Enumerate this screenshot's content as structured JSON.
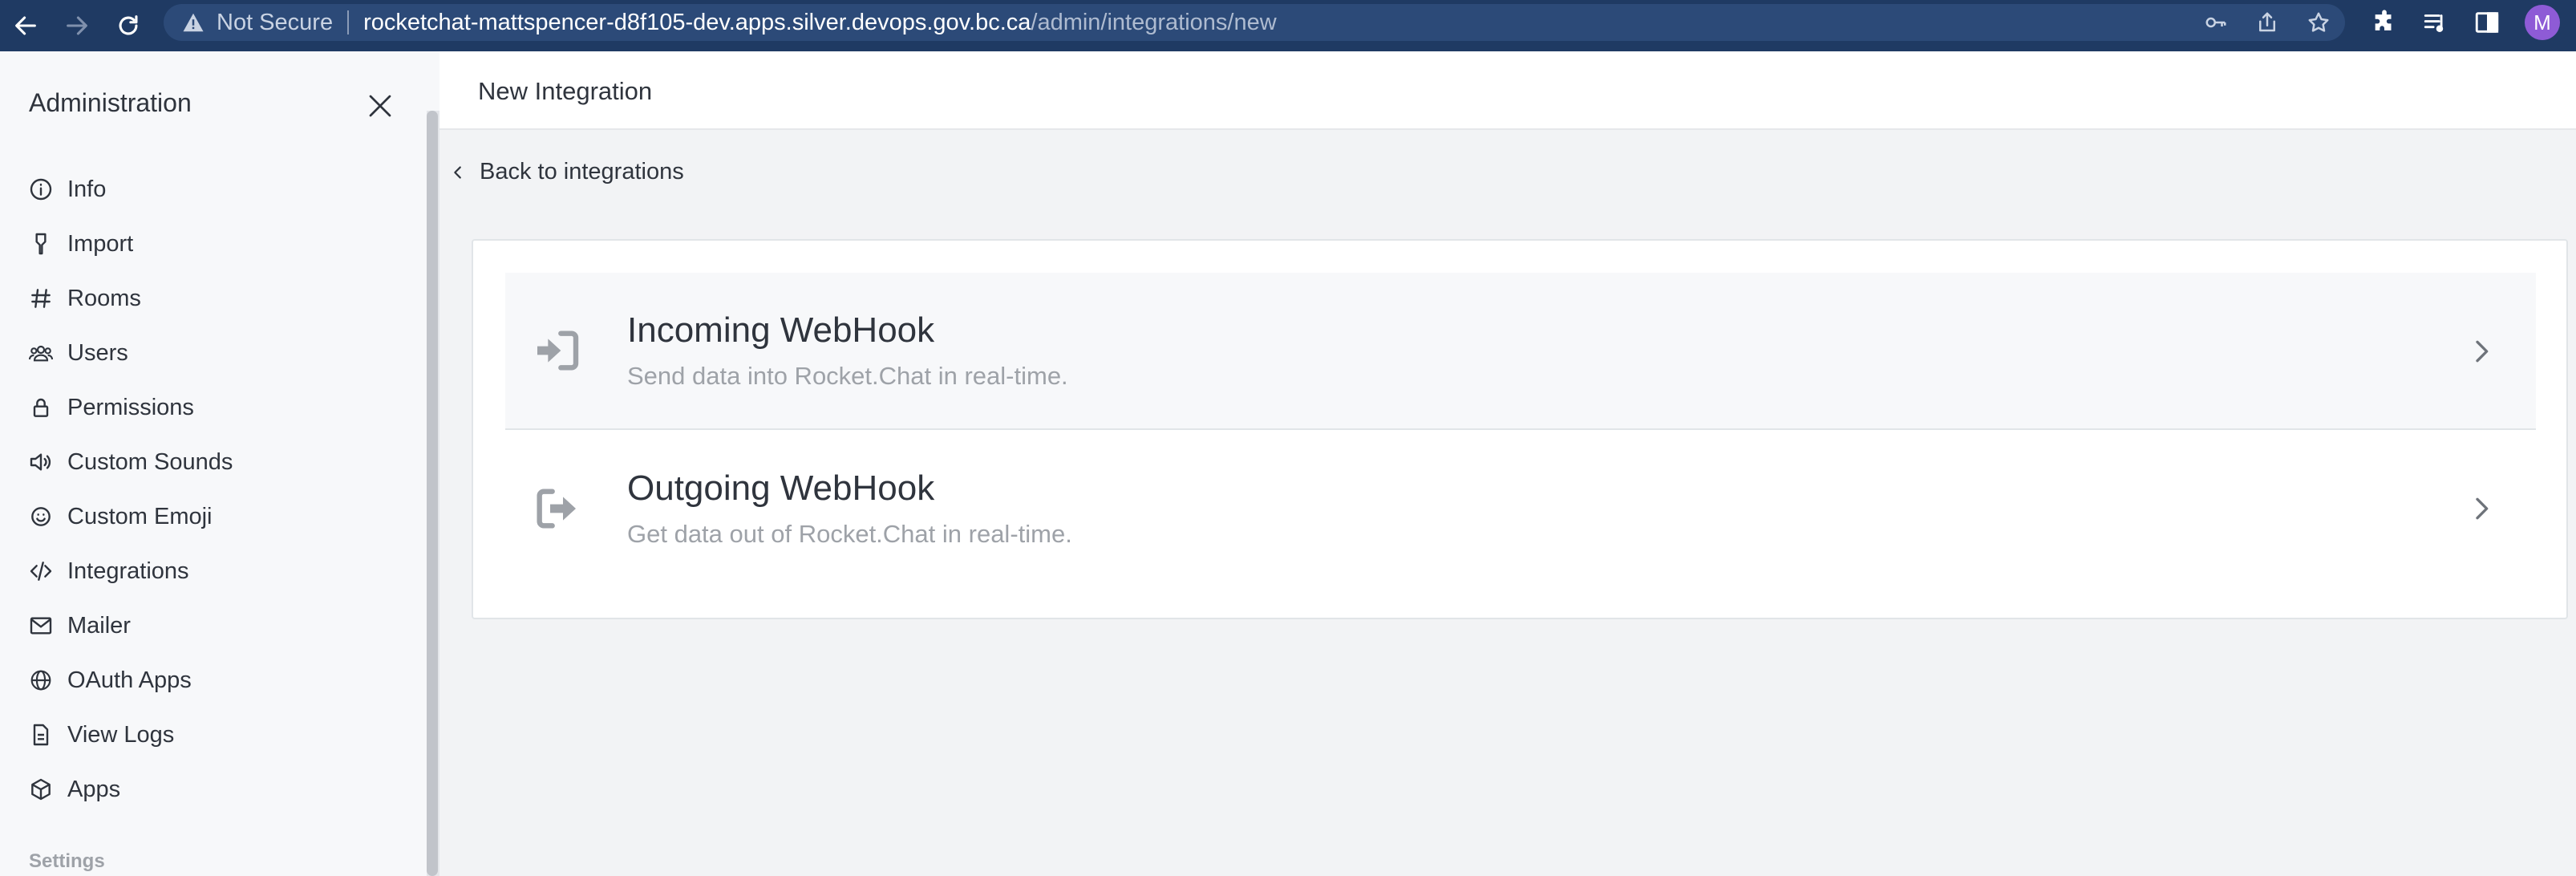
{
  "browser": {
    "not_secure": "Not Secure",
    "url_host": "rocketchat-mattspencer-d8f105-dev.apps.silver.devops.gov.bc.ca",
    "url_path": "/admin/integrations/new",
    "profile_initial": "M"
  },
  "sidebar": {
    "title": "Administration",
    "items": [
      {
        "label": "Info",
        "icon": "info-icon"
      },
      {
        "label": "Import",
        "icon": "import-icon"
      },
      {
        "label": "Rooms",
        "icon": "hashtag-icon"
      },
      {
        "label": "Users",
        "icon": "users-icon"
      },
      {
        "label": "Permissions",
        "icon": "lock-icon"
      },
      {
        "label": "Custom Sounds",
        "icon": "volume-icon"
      },
      {
        "label": "Custom Emoji",
        "icon": "emoji-icon"
      },
      {
        "label": "Integrations",
        "icon": "code-icon"
      },
      {
        "label": "Mailer",
        "icon": "mail-icon"
      },
      {
        "label": "OAuth Apps",
        "icon": "globe-icon"
      },
      {
        "label": "View Logs",
        "icon": "file-icon"
      },
      {
        "label": "Apps",
        "icon": "cube-icon"
      }
    ],
    "settings_label": "Settings"
  },
  "main": {
    "title": "New Integration",
    "back_label": "Back to integrations",
    "options": [
      {
        "title": "Incoming WebHook",
        "description": "Send data into Rocket.Chat in real-time.",
        "icon": "sign-in-icon"
      },
      {
        "title": "Outgoing WebHook",
        "description": "Get data out of Rocket.Chat in real-time.",
        "icon": "sign-out-icon"
      }
    ]
  },
  "colors": {
    "browser_bar": "#1f3a63",
    "sidebar_bg": "#f7f8fa",
    "main_bg": "#f2f3f5",
    "text_primary": "#2f343d",
    "text_secondary": "#9ea2a8"
  }
}
